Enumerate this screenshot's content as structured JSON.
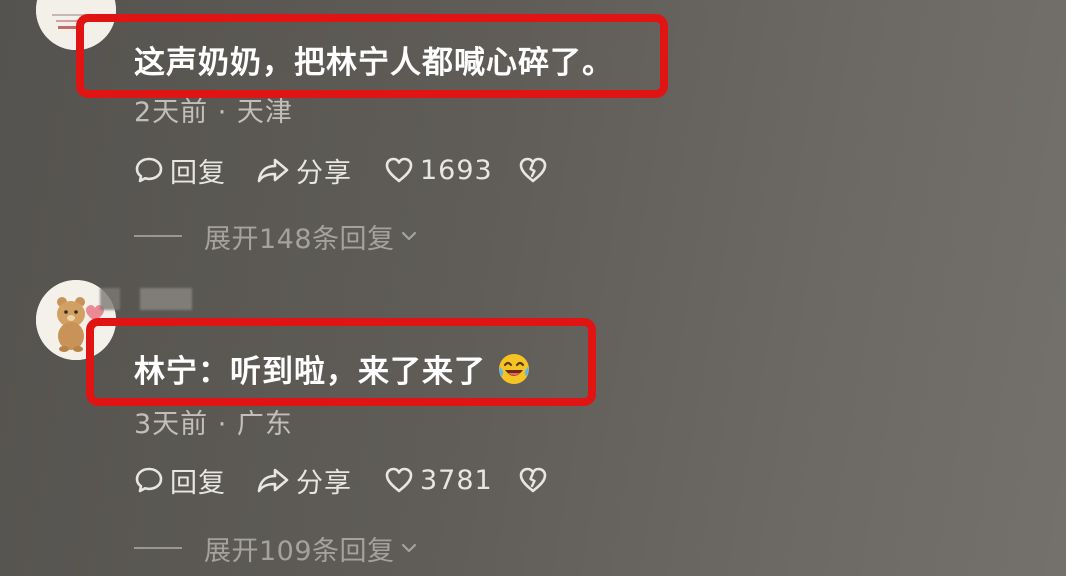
{
  "comments": [
    {
      "text": "这声奶奶，把林宁人都喊心碎了。",
      "meta": "2天前 · 天津",
      "actions": {
        "reply": "回复",
        "share": "分享",
        "likes": "1693"
      },
      "expand": "展开148条回复"
    },
    {
      "text": "林宁：听到啦，来了来了",
      "meta": "3天前 · 广东",
      "actions": {
        "reply": "回复",
        "share": "分享",
        "likes": "3781"
      },
      "expand": "展开109条回复"
    }
  ],
  "colors": {
    "highlight": "#e11414",
    "background": "#605d58"
  }
}
